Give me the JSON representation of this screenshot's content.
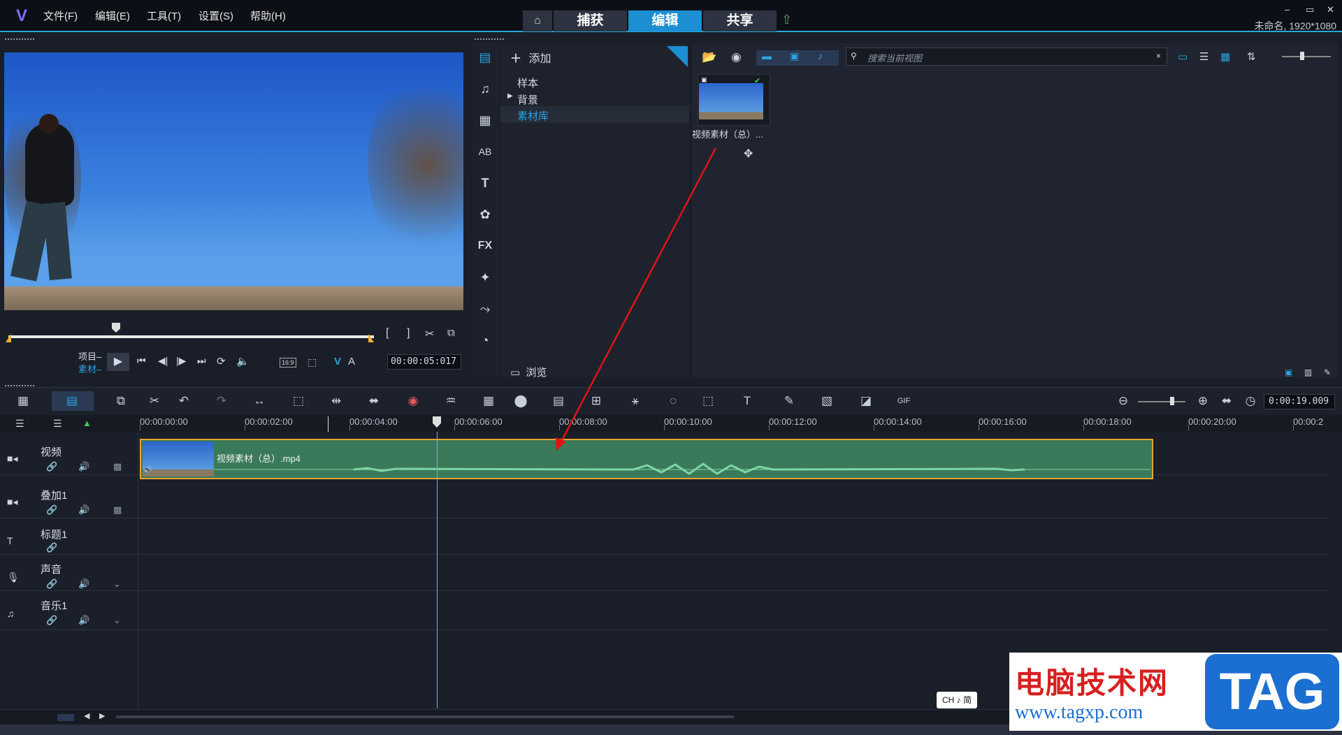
{
  "app": {
    "window_info": "未命名, 1920*1080",
    "menu": [
      "文件(F)",
      "编辑(E)",
      "工具(T)",
      "设置(S)",
      "帮助(H)"
    ],
    "tabs": [
      {
        "label": "捕获",
        "active": false
      },
      {
        "label": "编辑",
        "active": true
      },
      {
        "label": "共享",
        "active": false
      }
    ]
  },
  "player": {
    "project_label": "项目",
    "clip_label": "素材",
    "aspect": "16:9",
    "timecode": "00:00:05:017",
    "vmark": "V",
    "amark": "A"
  },
  "library": {
    "add_label": "添加",
    "tree": [
      "样本",
      "背景",
      "素材库"
    ],
    "browse_label": "浏览",
    "search_placeholder": "搜索当前视图",
    "thumb_label": "视频素材（总）..."
  },
  "timeline": {
    "duration": "0:00:19.009",
    "ruler": [
      "00:00:00:00",
      "00:00:02:00",
      "00:00:04:00",
      "00:00:06:00",
      "00:00:08:00",
      "00:00:10:00",
      "00:00:12:00",
      "00:00:14:00",
      "00:00:16:00",
      "00:00:18:00",
      "00:00:20:00",
      "00:00:2"
    ],
    "tracks": [
      "视频",
      "叠加1",
      "标题1",
      "声音",
      "音乐1"
    ],
    "clip_name": "视频素材（总）.mp4"
  },
  "ime": "CH ♪ 简",
  "watermark": {
    "title": "电脑技术网",
    "url": "www.tagxp.com",
    "badge": "TAG"
  },
  "colors": {
    "accent": "#1b8fd2",
    "clip": "#3a7a5a",
    "arrow": "#e01414"
  }
}
